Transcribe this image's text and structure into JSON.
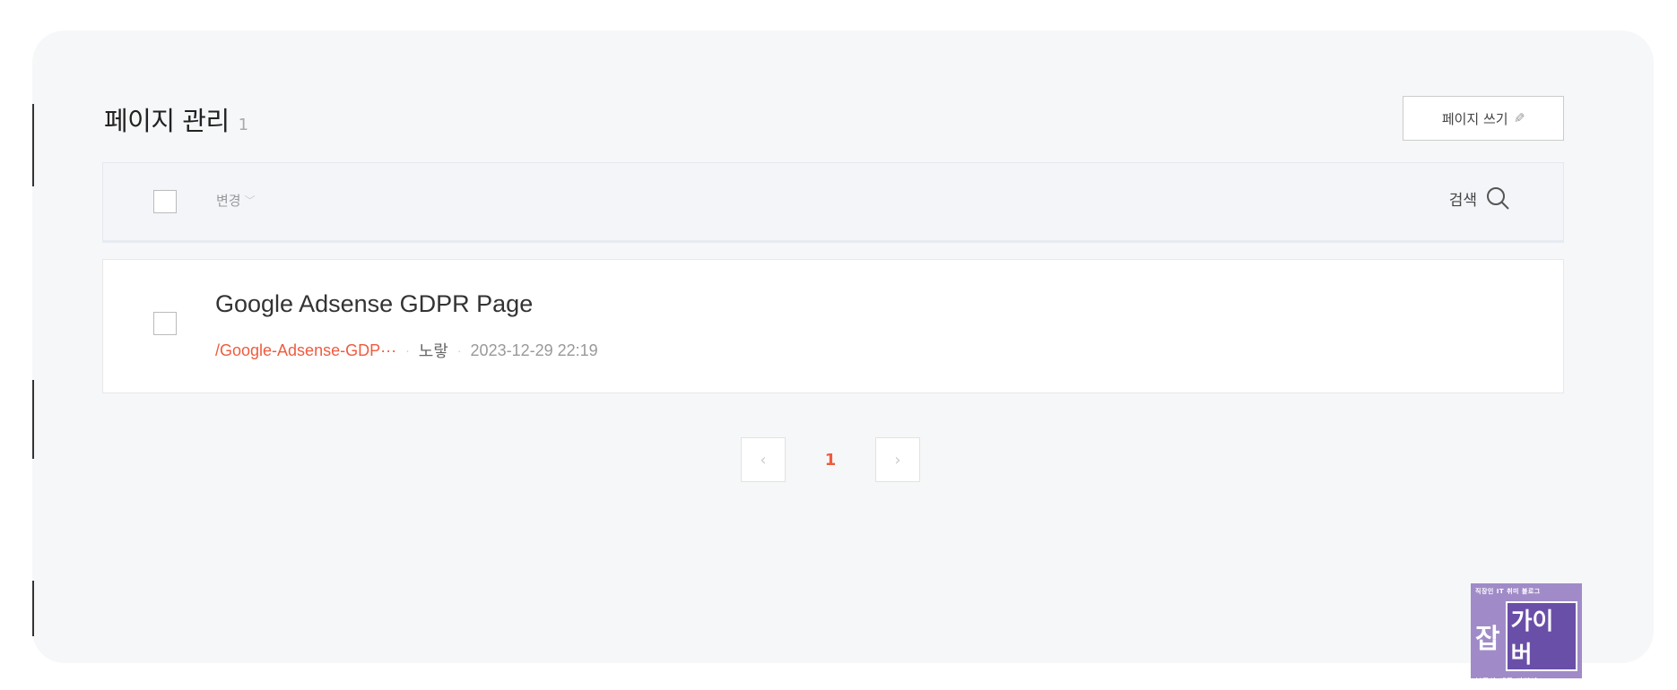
{
  "header": {
    "title": "페이지 관리",
    "count": "1",
    "write_button_label": "페이지 쓰기",
    "write_icon": "pencil-icon"
  },
  "toolbar": {
    "sort_label": "변경",
    "sort_icon": "chevron-down-icon",
    "search_label": "검색",
    "search_icon": "search-icon"
  },
  "pages": [
    {
      "title": "Google Adsense GDPR Page",
      "slug": "/Google-Adsense-GDP···",
      "author": "노랗",
      "date": "2023-12-29 22:19"
    }
  ],
  "pagination": {
    "current": "1",
    "prev_icon": "chevron-left-icon",
    "next_icon": "chevron-right-icon"
  },
  "watermark": {
    "top": "직장인 IT 취미 블로그",
    "big_left": "잡",
    "big_right": "가이버",
    "bottom": "부동산 세금 자전거"
  },
  "colors": {
    "accent": "#ef5b3f",
    "panel_bg": "#f6f7f8",
    "watermark_bg": "#a08bc8"
  }
}
